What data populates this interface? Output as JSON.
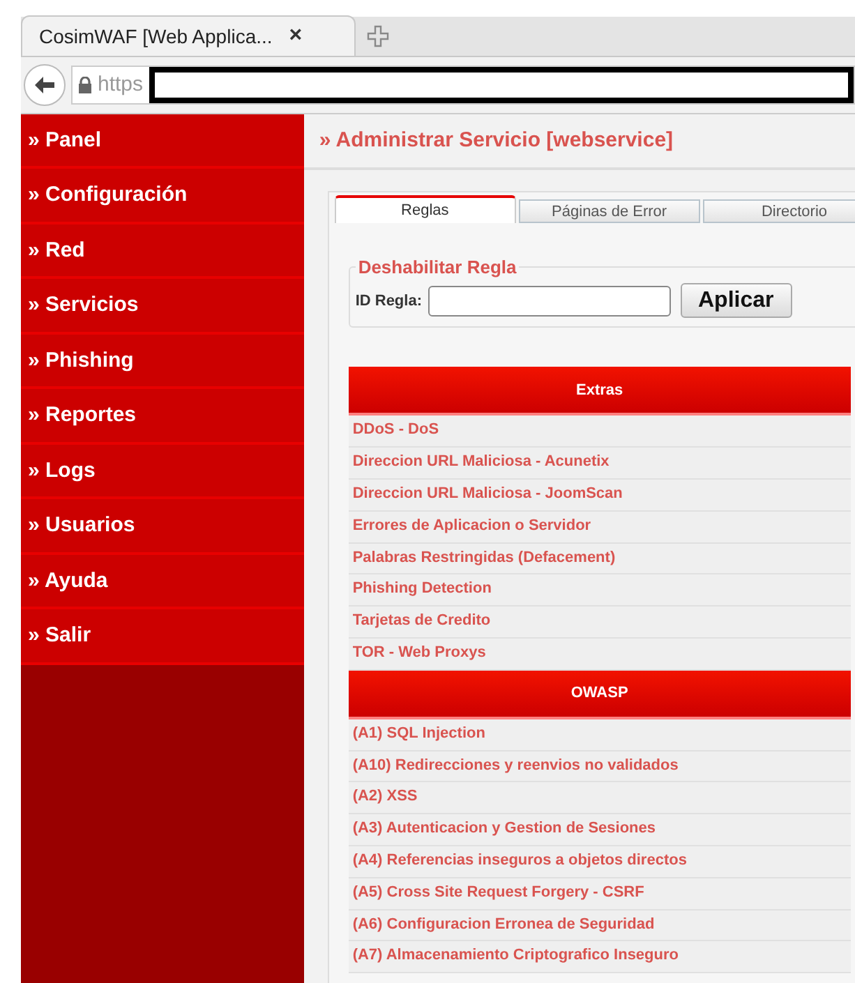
{
  "browser": {
    "tab_title": "CosimWAF [Web Applica...",
    "tab_close": "×",
    "url_prefix": "https"
  },
  "sidebar": {
    "items": [
      {
        "label": "» Panel"
      },
      {
        "label": "» Configuración"
      },
      {
        "label": "» Red"
      },
      {
        "label": "» Servicios"
      },
      {
        "label": "» Phishing"
      },
      {
        "label": "» Reportes"
      },
      {
        "label": "» Logs"
      },
      {
        "label": "» Usuarios"
      },
      {
        "label": "» Ayuda"
      },
      {
        "label": "» Salir"
      }
    ]
  },
  "page_title": "» Administrar Servicio [webservice]",
  "tabs": [
    {
      "label": "Reglas",
      "selected": true
    },
    {
      "label": "Páginas de Error",
      "selected": false
    },
    {
      "label": "Directorio",
      "selected": false
    }
  ],
  "disable_rule": {
    "legend": "Deshabilitar Regla",
    "label": "ID Regla:",
    "button": "Aplicar"
  },
  "rule_groups": [
    {
      "title": "Extras",
      "rows": [
        "DDoS - DoS",
        "Direccion URL Maliciosa - Acunetix",
        "Direccion URL Maliciosa - JoomScan",
        "Errores de Aplicacion o Servidor",
        "Palabras Restringidas (Defacement)",
        "Phishing Detection",
        "Tarjetas de Credito",
        "TOR - Web Proxys"
      ]
    },
    {
      "title": "OWASP",
      "rows": [
        "(A1) SQL Injection",
        "(A10) Redirecciones y reenvios no validados",
        "(A2) XSS",
        "(A3) Autenticacion y Gestion de Sesiones",
        "(A4) Referencias inseguros a objetos directos",
        "(A5) Cross Site Request Forgery - CSRF",
        "(A6) Configuracion Erronea de Seguridad",
        "(A7) Almacenamiento Criptografico Inseguro"
      ]
    }
  ]
}
